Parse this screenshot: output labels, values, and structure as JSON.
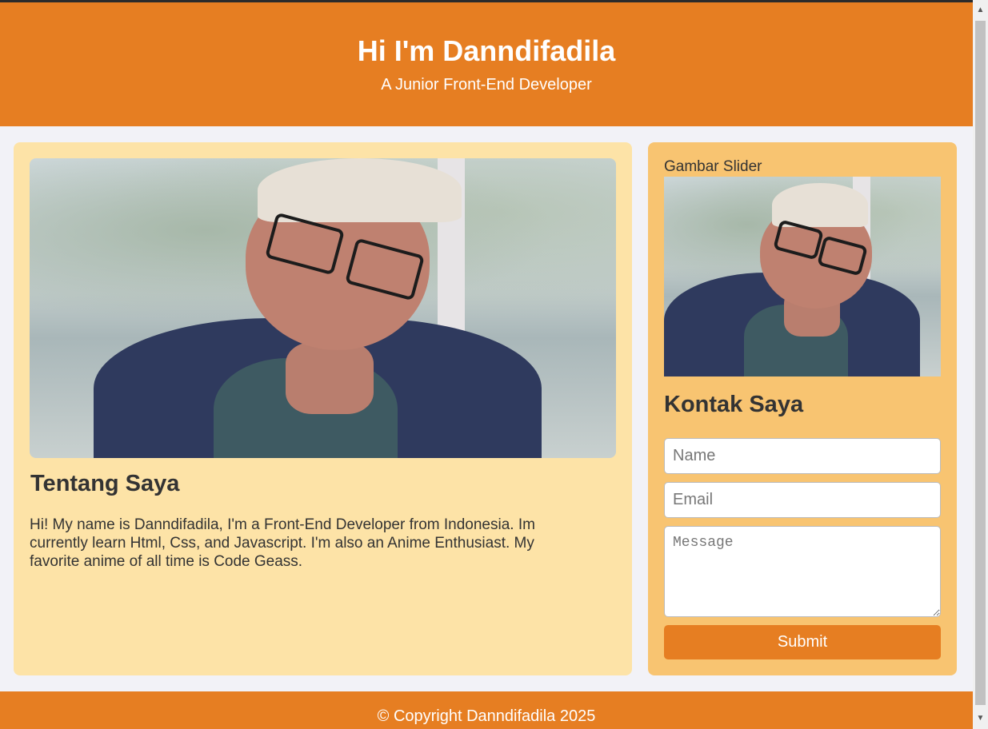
{
  "header": {
    "title": "Hi I'm Danndifadila",
    "subtitle": "A Junior Front-End Developer"
  },
  "about": {
    "heading": "Tentang Saya",
    "text": "Hi! My name is Danndifadila, I'm a Front-End Developer from Indonesia. Im currently learn Html, Css, and Javascript. I'm also an Anime Enthusiast. My favorite anime of all time is Code Geass."
  },
  "sidebar": {
    "slider_label": "Gambar Slider",
    "contact_heading": "Kontak Saya",
    "name_placeholder": "Name",
    "email_placeholder": "Email",
    "message_placeholder": "Message",
    "submit_label": "Submit"
  },
  "footer": {
    "copyright": "© Copyright Danndifadila 2025"
  },
  "colors": {
    "accent": "#e67e22",
    "about_bg": "#fde3a7",
    "sidebar_bg": "#f8c471"
  }
}
